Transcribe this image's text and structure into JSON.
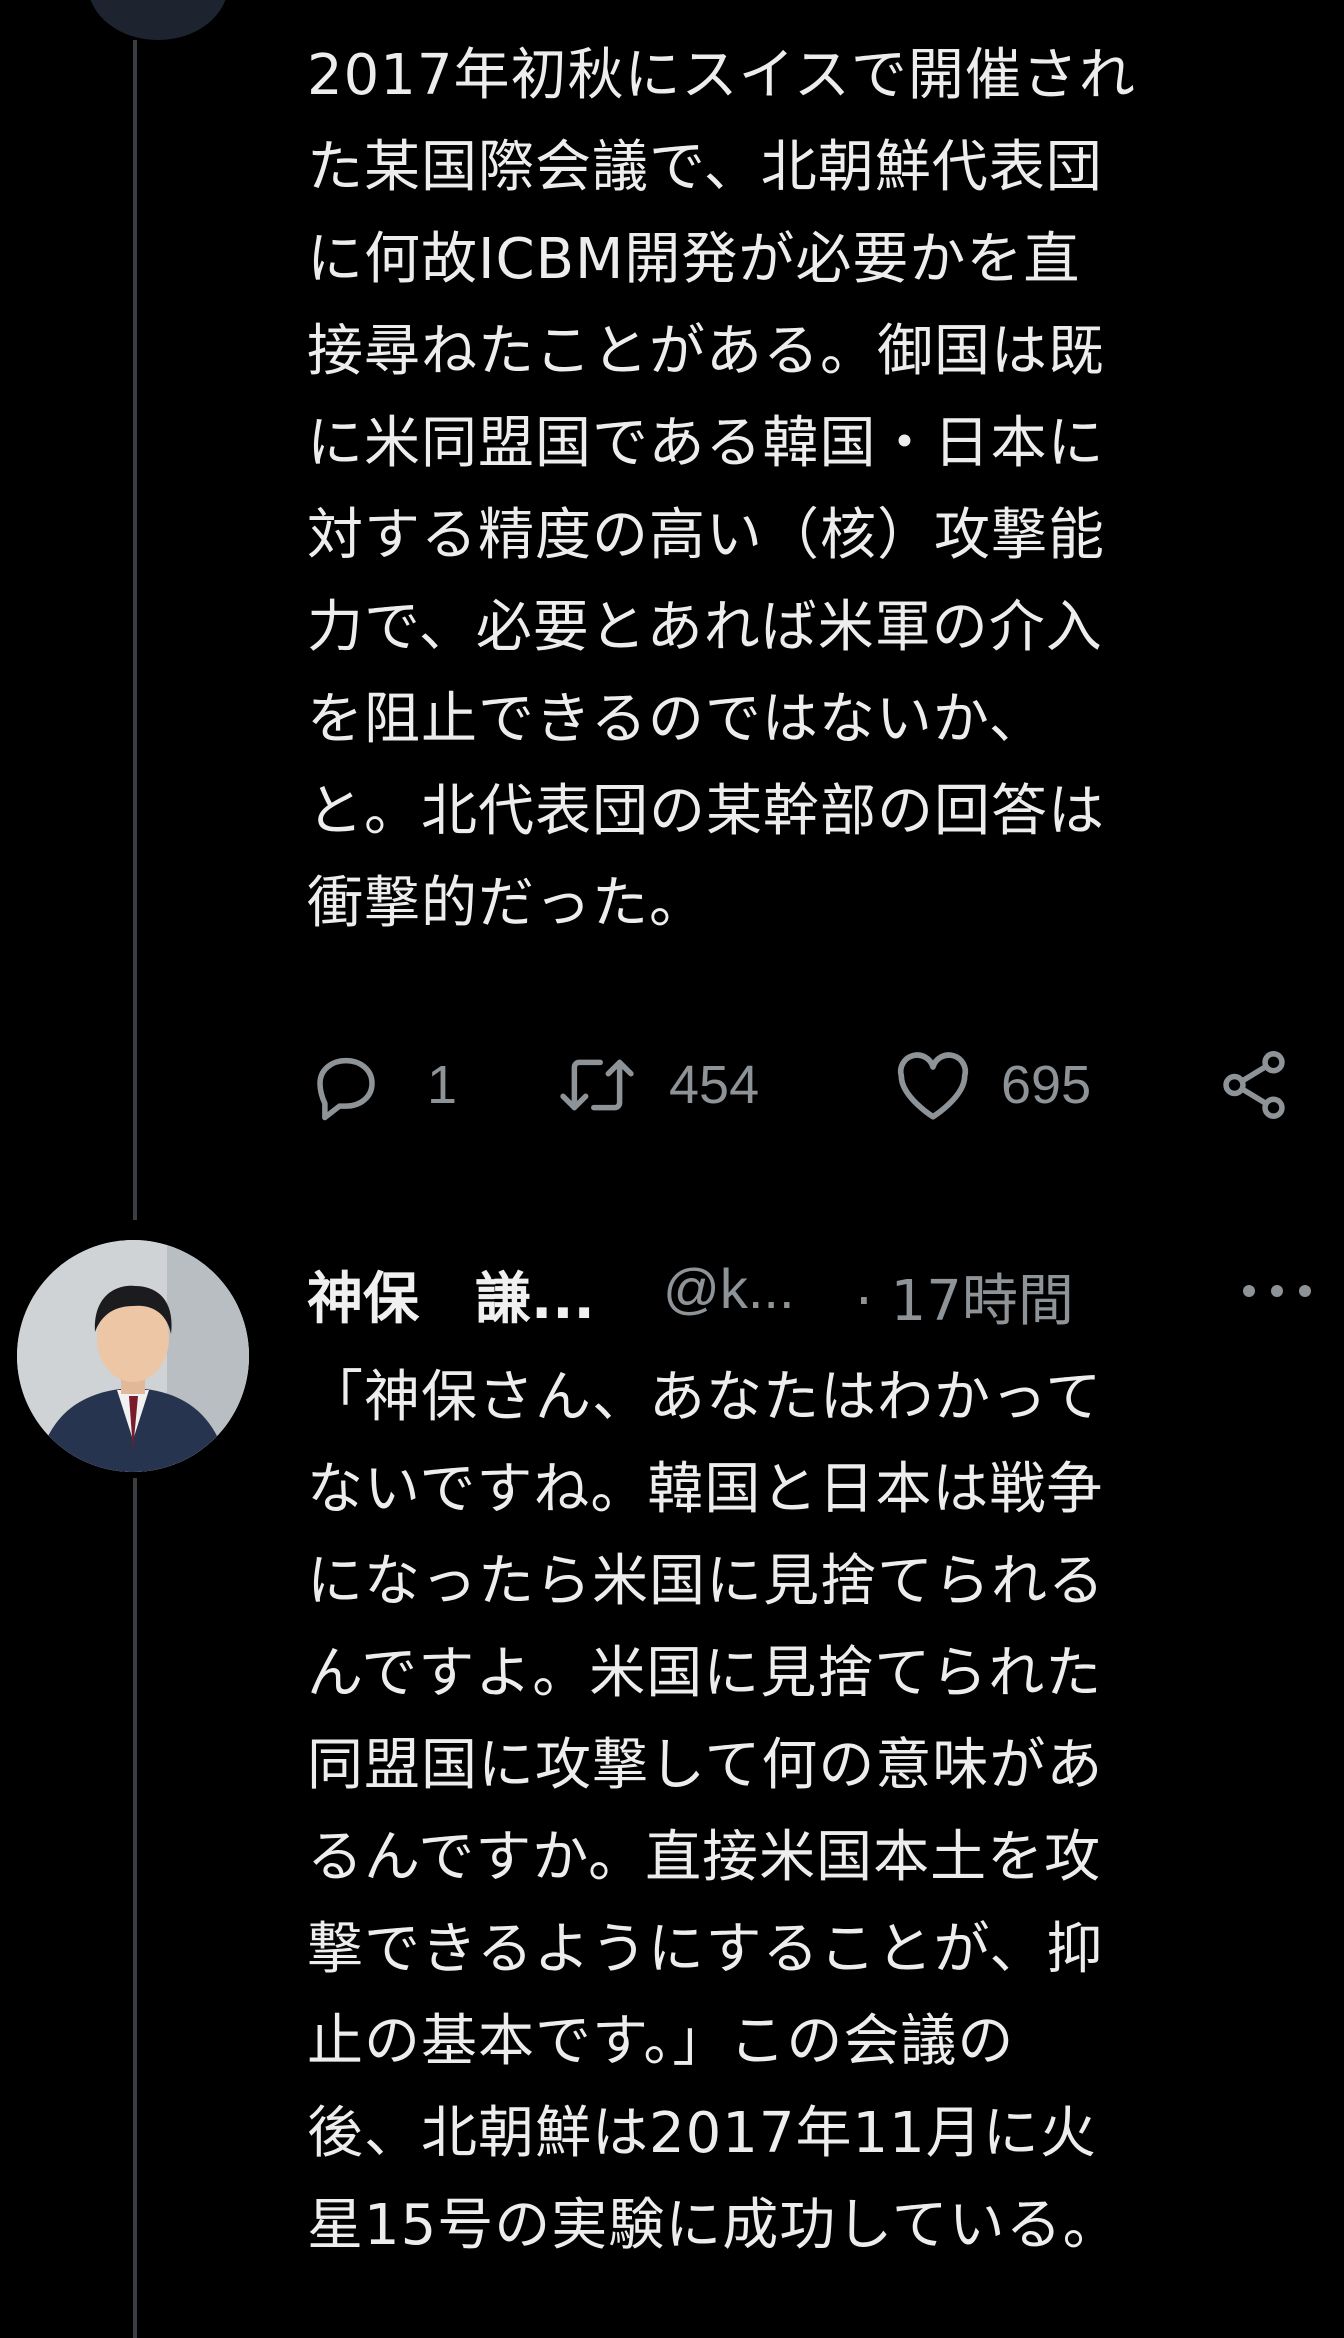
{
  "tweet1": {
    "lines": [
      "2017年初秋にスイスで開催され",
      "た某国際会議で、北朝鮮代表団",
      "に何故ICBM開発が必要かを直",
      "接尋ねたことがある。御国は既",
      "に米同盟国である韓国・日本に",
      "対する精度の高い（核）攻撃能",
      "力で、必要とあれば米軍の介入",
      "を阻止できるのではないか、",
      "と。北代表団の某幹部の回答は",
      "衝撃的だった。"
    ],
    "replies": "1",
    "retweets": "454",
    "likes": "695"
  },
  "tweet2": {
    "name": "神保　謙...",
    "handle": "@k...",
    "time": "· 17時間",
    "lines": [
      "「神保さん、あなたはわかって",
      "ないですね。韓国と日本は戦争",
      "になったら米国に見捨てられる",
      "んですよ。米国に見捨てられた",
      "同盟国に攻撃して何の意味があ",
      "るんですか。直接米国本土を攻",
      "撃できるようにすることが、抑",
      "止の基本です。」この会議の",
      "後、北朝鮮は2017年11月に火",
      "星15号の実験に成功している。"
    ]
  },
  "icons": [
    "reply-icon",
    "retweet-icon",
    "like-icon",
    "share-icon",
    "more-icon"
  ],
  "colors": {
    "background": "#000000",
    "text": "#ededed",
    "secondary": "#8e9397",
    "thread_line": "#3a3d41"
  }
}
